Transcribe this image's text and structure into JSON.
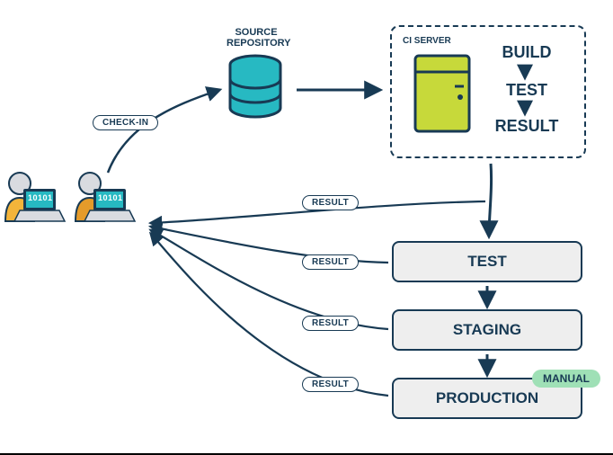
{
  "diagram": {
    "source_repo_label": "SOURCE\nREPOSITORY",
    "ci_server_label": "CI SERVER",
    "ci_steps": {
      "build": "BUILD",
      "test": "TEST",
      "result": "RESULT"
    },
    "checkin_label": "CHECK-IN",
    "result_pill": "RESULT",
    "stages": {
      "test": "TEST",
      "staging": "STAGING",
      "production": "PRODUCTION"
    },
    "manual_badge": "MANUAL",
    "dev_screen_text": "10101"
  }
}
